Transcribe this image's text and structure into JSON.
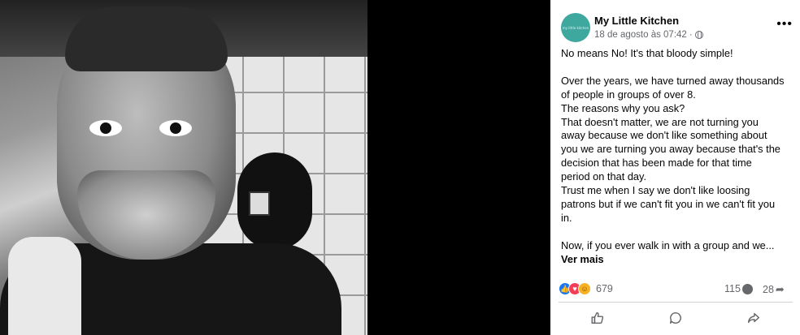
{
  "post": {
    "page_name": "My Little Kitchen",
    "avatar_text": "my little kitchen",
    "date": "18 de agosto às 07:42",
    "dot": "·",
    "more_icon": "more-horizontal-icon",
    "text_lines": [
      "No means No! It's that bloody simple!",
      "",
      "Over the years, we have turned away thousands",
      "of people in groups of over 8.",
      "The reasons why you ask?",
      "That doesn't matter, we are not turning you",
      "away because we don't like something about",
      "you we are turning you away because that's the",
      "decision that has been made for that time",
      "period on that day.",
      "Trust me when I say we don't like loosing",
      "patrons but if we can't fit you in we can't fit you",
      "in.",
      "",
      "Now, if you ever walk in with a group and we..."
    ],
    "see_more": "Ver mais"
  },
  "stats": {
    "reactions_count": "679",
    "comments_count": "115",
    "shares_count": "28",
    "reaction_icons": [
      "like-icon",
      "love-icon",
      "care-icon"
    ]
  },
  "actions": {
    "like_icon": "thumbs-up-icon",
    "comment_icon": "comment-icon",
    "share_icon": "share-icon"
  },
  "colors": {
    "like_blue": "#1877f2",
    "love_red": "#f33e58",
    "care_yellow": "#f7b125",
    "secondary_text": "#65676b",
    "avatar_teal": "#3ea89e"
  }
}
